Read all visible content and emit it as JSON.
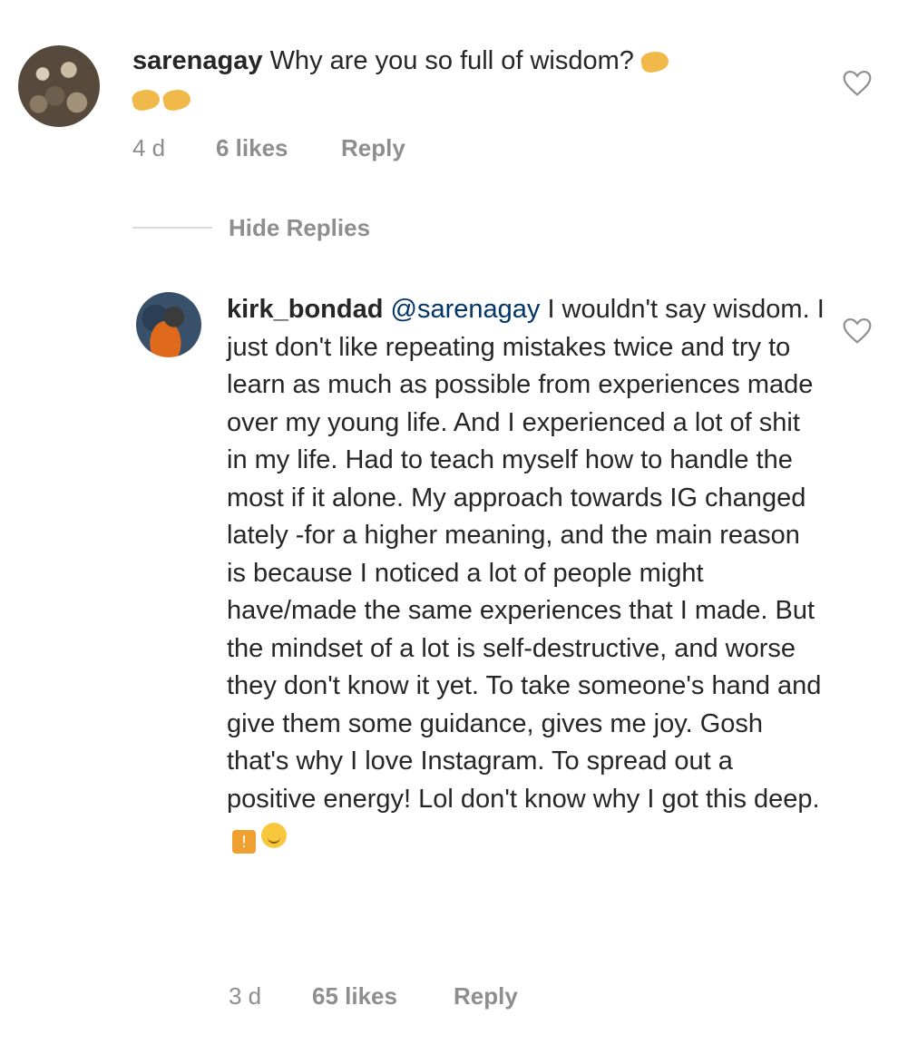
{
  "comments": [
    {
      "username": "sarenagay",
      "text": "Why are you so full of wisdom?",
      "emoji": "pizza-emoji",
      "time": "4 d",
      "likes": "6 likes",
      "reply_label": "Reply"
    },
    {
      "username": "kirk_bondad",
      "mention": "@sarenagay",
      "text": "I wouldn't say wisdom. I just don't like repeating mistakes twice and try to learn as much as possible from experiences made over my young life. And I experienced a lot of shit in my life. Had to teach myself how to handle the most if it alone. My approach towards IG changed lately -for a higher meaning, and the main reason is because I noticed a lot of people might have/made the same experiences that I made. But  the mindset of a lot is self-destructive, and worse they don't know it yet. To take someone's hand and give them some guidance, gives me joy. Gosh that's why I love Instagram. To spread out a positive energy! Lol don't know why I got this deep.",
      "time": "3 d",
      "likes": "65 likes",
      "reply_label": "Reply"
    }
  ],
  "hide_replies_label": "Hide Replies",
  "icons": {
    "like": "heart-outline-icon",
    "emoji_1": "pizza-emoji",
    "emoji_2": "sign-emoji",
    "emoji_3": "smile-emoji"
  },
  "colors": {
    "text": "#262626",
    "secondary": "#8e8e8e",
    "mention": "#003569",
    "divider": "#dbdbdb"
  }
}
